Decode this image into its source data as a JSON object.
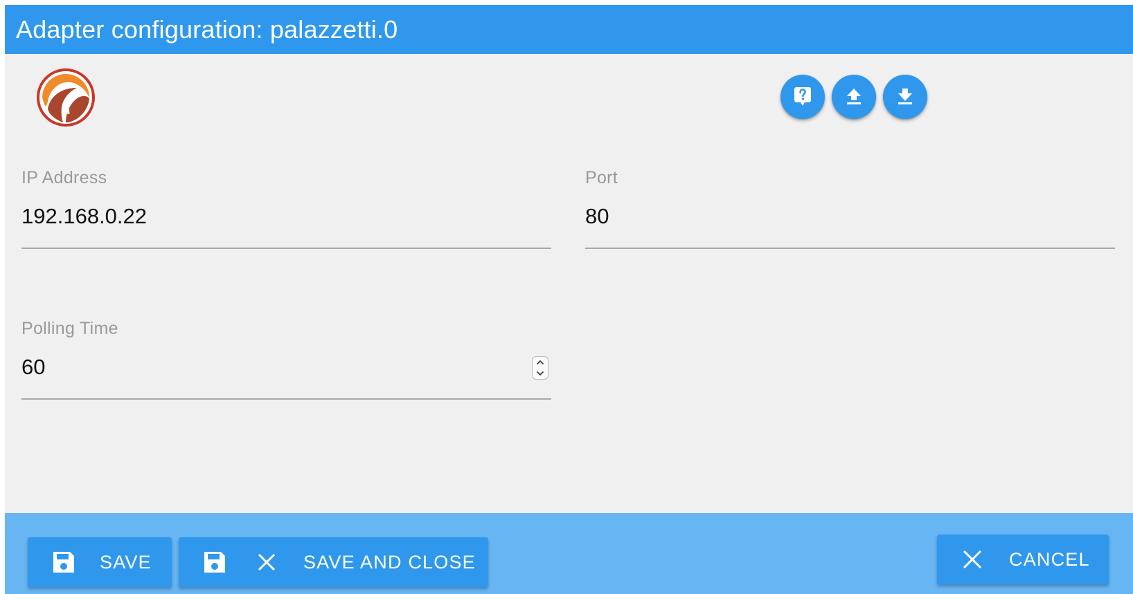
{
  "window": {
    "title": "Adapter configuration: palazzetti.0"
  },
  "logo": {
    "icon": "palazzetti-flame-logo-icon",
    "colors": {
      "ring": "#c8382b",
      "flame_outer": "#f08a2a",
      "flame_inner": "#a9462e"
    }
  },
  "toolbar": {
    "buttons": [
      {
        "icon": "help-icon",
        "action": "help"
      },
      {
        "icon": "upload-icon",
        "action": "upload"
      },
      {
        "icon": "download-icon",
        "action": "download"
      }
    ]
  },
  "form": {
    "ip": {
      "label": "IP Address",
      "value": "192.168.0.22"
    },
    "port": {
      "label": "Port",
      "value": "80"
    },
    "polling": {
      "label": "Polling Time",
      "value": "60"
    }
  },
  "footer": {
    "save_label": "SAVE",
    "save_close_label": "SAVE AND CLOSE",
    "cancel_label": "CANCEL"
  },
  "colors": {
    "accent": "#2f98ed",
    "footer_bg": "#68b5f4",
    "content_bg": "#f0f0f0"
  }
}
